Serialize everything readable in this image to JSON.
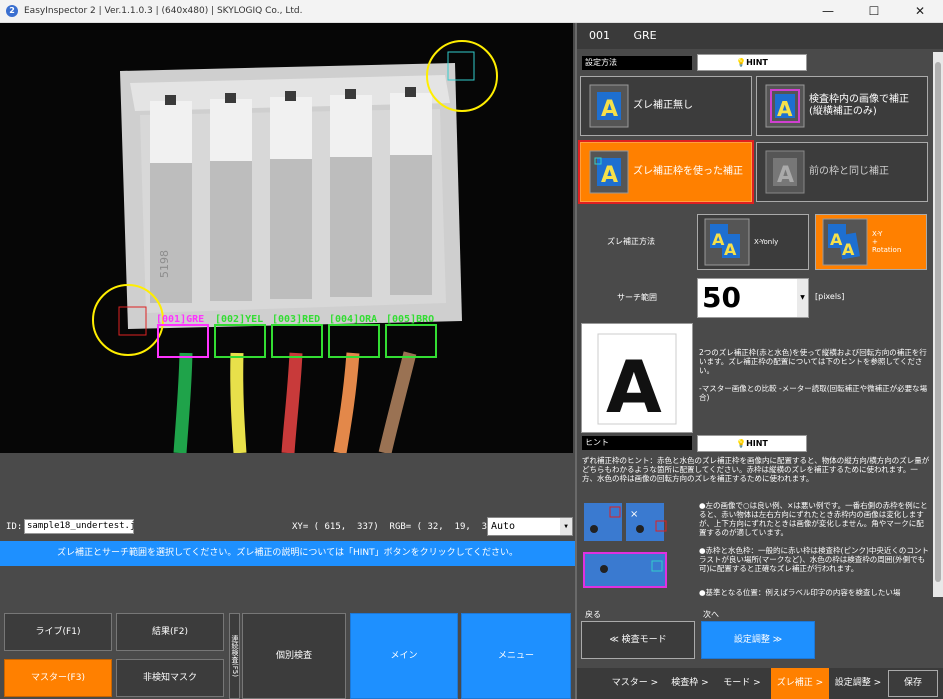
{
  "window": {
    "title": "EasyInspector 2 | Ver.1.1.0.3 | (640x480) | SKYLOGIQ Co., Ltd.",
    "app_icon": "2",
    "minimize": "—",
    "maximize": "☐",
    "close": "✕"
  },
  "camera": {
    "box_labels": [
      "[001]GRE",
      "[002]YEL",
      "[003]RED",
      "[004]ORA",
      "[005]BRO"
    ],
    "connector_text": "5198"
  },
  "status": {
    "id_label": "ID:",
    "id_value": "sample18_undertest.j",
    "coords": "XY= ( 615,  337)  RGB= ( 32,  19,  39)",
    "display_mode": "Auto"
  },
  "message": "ズレ補正とサーチ範囲を選択してください。ズレ補正の説明については「HINT」ボタンをクリックしてください。",
  "bottom_buttons": {
    "live": "ライブ(F1)",
    "result": "結果(F2)",
    "master": "マスター(F3)",
    "nondetect_mask": "非検知マスク",
    "vertical_tab": "連続検査(F5)",
    "individual": "個別検査",
    "main": "メイン",
    "menu": "メニュー"
  },
  "right": {
    "header_id": "001",
    "header_name": "GRE",
    "method_label": "設定方法",
    "hint": "HINT",
    "options": {
      "none": "ズレ補正無し",
      "inframe": "検査枠内の画像で補正\n(縦横補正のみ)",
      "frame": "ズレ補正枠を使った補正",
      "same": "前の枠と同じ補正"
    },
    "method2_label": "ズレ補正方法",
    "xy_only": "X-Yonly",
    "xy_rot": "X-Y\n+\nRotation",
    "search_label": "サーチ範囲",
    "search_value": "50",
    "search_unit": "[pixels]",
    "sample_letter": "A",
    "desc1": "2つのズレ補正枠(赤と水色)を使って縦横および回転方向の補正を行います。ズレ補正枠の配置については下のヒントを参照してください。",
    "desc2": "-マスター画像との比較 -メーター読取(回転補正や微補正が必要な場合)",
    "hint_label": "ヒント",
    "hint_text": "ずれ補正枠のヒント：赤色と水色のズレ補正枠を画像内に配置すると、物体の縦方向/横方向のズレ量がどちらもわかるような箇所に配置してください。赤枠は縦横のズレを補正するために使われます。一方、水色の枠は画像の回転方向のズレを補正するために使われます。",
    "hint_bullet1": "●左の画像で○は良い例、×は悪い例です。一番右側の赤枠を例にとると、赤い物体は左右方向にずれたとき赤枠内の画像は変化しますが、上下方向にずれたときは画像が変化しません。角やマークに配置するのが適しています。",
    "hint_bullet2": "●赤枠と水色枠：一般的に赤い枠は検査枠(ピンク)中央近くのコントラストが良い場所(マークなど)、水色の枠は検査枠の周囲(外側でも可)に配置すると正確なズレ補正が行われます。",
    "hint_bullet3": "●基準となる位置：例えばラベル印字の内容を検査したい場",
    "back_label": "戻る",
    "next_label": "次へ",
    "back_btn": "≪ 検査モード",
    "next_btn": "設定調整 ≫",
    "crumbs": [
      "マスター >",
      "検査枠 >",
      "モード >",
      "ズレ補正 >",
      "設定調整 >"
    ],
    "save": "保存"
  },
  "colors": {
    "accent_orange": "#ff8000",
    "accent_blue": "#1e90ff",
    "box_magenta": "#ff33ff",
    "box_green": "#33dd33",
    "circle_yellow": "#ffee00"
  }
}
